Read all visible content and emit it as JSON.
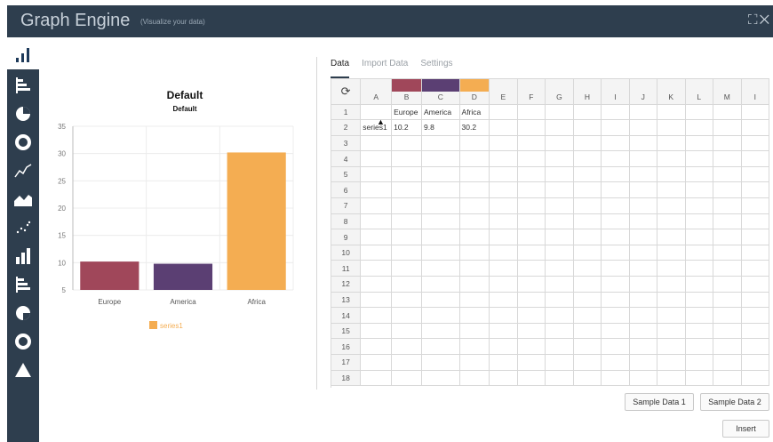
{
  "header": {
    "title": "Graph Engine",
    "subtitle": "(Visualize your data)"
  },
  "sidebar": {
    "items": [
      {
        "icon": "bar-chart-icon"
      },
      {
        "icon": "horizontal-bar-chart-icon"
      },
      {
        "icon": "pie-chart-icon"
      },
      {
        "icon": "donut-chart-icon"
      },
      {
        "icon": "line-chart-icon"
      },
      {
        "icon": "area-chart-icon"
      },
      {
        "icon": "scatter-chart-icon"
      },
      {
        "icon": "column-chart-icon"
      },
      {
        "icon": "stacked-bar-chart-icon"
      },
      {
        "icon": "pie-chart-icon"
      },
      {
        "icon": "donut-chart-icon"
      },
      {
        "icon": "pyramid-chart-icon"
      }
    ]
  },
  "tabs": [
    {
      "label": "Data",
      "active": true
    },
    {
      "label": "Import Data",
      "active": false
    },
    {
      "label": "Settings",
      "active": false
    }
  ],
  "grid": {
    "columns": [
      "A",
      "B",
      "C",
      "D",
      "E",
      "F",
      "G",
      "H",
      "I",
      "J",
      "K",
      "L",
      "M",
      "I"
    ],
    "column_colors": {
      "B": "#a0475a",
      "C": "#5b3f73",
      "D": "#f4ad52"
    },
    "rows": [
      {
        "num": "1",
        "cells": [
          "",
          "Europe",
          "America",
          "Africa"
        ]
      },
      {
        "num": "2",
        "cells": [
          "series1",
          "10.2",
          "9.8",
          "30.2"
        ]
      },
      {
        "num": "3",
        "cells": []
      },
      {
        "num": "4",
        "cells": []
      },
      {
        "num": "5",
        "cells": []
      },
      {
        "num": "6",
        "cells": []
      },
      {
        "num": "7",
        "cells": []
      },
      {
        "num": "8",
        "cells": []
      },
      {
        "num": "9",
        "cells": []
      },
      {
        "num": "10",
        "cells": []
      },
      {
        "num": "11",
        "cells": []
      },
      {
        "num": "12",
        "cells": []
      },
      {
        "num": "13",
        "cells": []
      },
      {
        "num": "14",
        "cells": []
      },
      {
        "num": "15",
        "cells": []
      },
      {
        "num": "16",
        "cells": []
      },
      {
        "num": "17",
        "cells": []
      },
      {
        "num": "18",
        "cells": []
      }
    ]
  },
  "buttons": {
    "sample1": "Sample Data 1",
    "sample2": "Sample Data 2",
    "insert": "Insert"
  },
  "chart_data": {
    "type": "bar",
    "title": "Default",
    "subtitle": "Default",
    "categories": [
      "Europe",
      "America",
      "Africa"
    ],
    "series": [
      {
        "name": "series1",
        "values": [
          10.2,
          9.8,
          30.2
        ],
        "colors": [
          "#a0475a",
          "#5b3f73",
          "#f4ad52"
        ]
      }
    ],
    "yticks": [
      5,
      10,
      15,
      20,
      25,
      30,
      35
    ],
    "ylim": [
      5,
      35
    ],
    "grid": true,
    "legend": "bottom",
    "legend_color": "#f4ad52"
  }
}
